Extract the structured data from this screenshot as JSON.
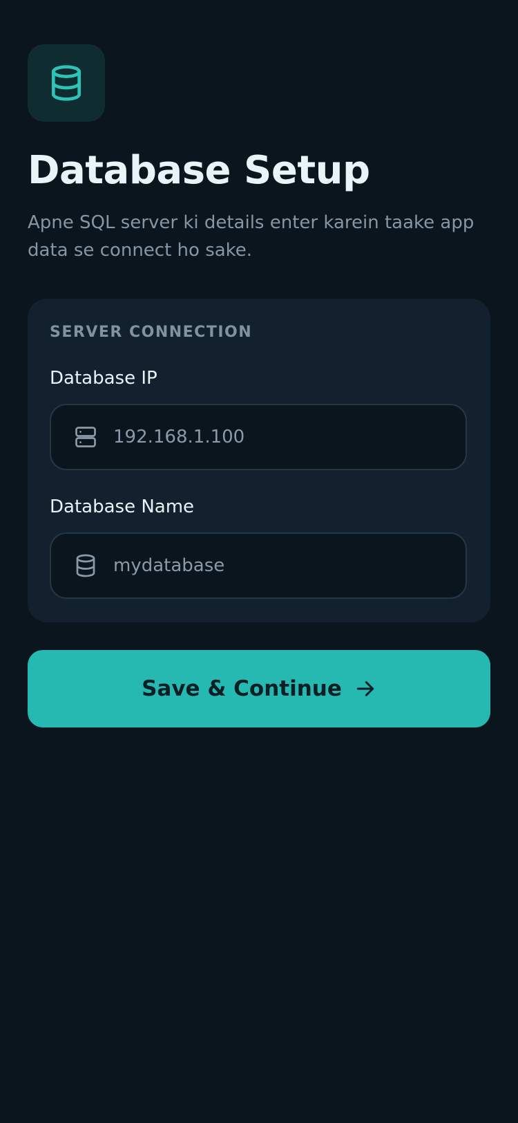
{
  "header": {
    "app_icon": "database-icon",
    "title": "Database Setup",
    "subtitle": "Apne SQL server ki details enter karein taake app data se connect ho sake."
  },
  "connection_card": {
    "section_label": "SERVER CONNECTION",
    "fields": [
      {
        "label": "Database IP",
        "icon": "server-icon",
        "value": "",
        "placeholder": "192.168.1.100"
      },
      {
        "label": "Database Name",
        "icon": "database-icon",
        "value": "",
        "placeholder": "mydatabase"
      }
    ]
  },
  "actions": {
    "primary_label": "Save & Continue",
    "primary_icon": "arrow-right-icon"
  },
  "colors": {
    "background": "#0b151e",
    "card": "#13212e",
    "accent": "#26b9b1",
    "icon_tile": "#0f2c30",
    "text_primary": "#e9f3f8",
    "text_muted": "#8597a5"
  }
}
